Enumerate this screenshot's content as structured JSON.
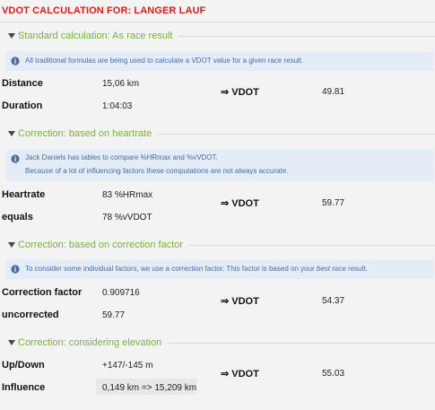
{
  "page": {
    "title": "VDOT CALCULATION FOR: LANGER LAUF"
  },
  "arrow": "⇒",
  "colors": {
    "title": "#e31b1b",
    "section": "#7bb13a",
    "info_bg": "#e3ecf7",
    "info_text": "#4a6ea0"
  },
  "sections": [
    {
      "heading": "Standard calculation: As race result",
      "info": [
        "All traditional formulas are being used to calculate a VDOT value for a given race result."
      ],
      "rows": [
        {
          "label": "Distance",
          "value": "15,06 km"
        },
        {
          "label": "Duration",
          "value": "1:04:03"
        }
      ],
      "vdot_label": "⇒ VDOT",
      "vdot_value": "49.81"
    },
    {
      "heading": "Correction: based on heartrate",
      "info": [
        "Jack Daniels has tables to compare %HRmax and %vVDOT.",
        "Because of a lot of influencing factors these computations are not always accurate."
      ],
      "rows": [
        {
          "label": "Heartrate",
          "value": "83 %HRmax"
        },
        {
          "label": "equals",
          "value": "78 %vVDOT"
        }
      ],
      "vdot_label": "⇒ VDOT",
      "vdot_value": "59.77"
    },
    {
      "heading": "Correction: based on correction factor",
      "info_parts": {
        "before": "To consider some individual factors, we use a correction factor. This factor is based on your ",
        "em": "best",
        "after": " race result."
      },
      "rows": [
        {
          "label": "Correction factor",
          "value": "0.909716"
        },
        {
          "label": "uncorrected",
          "value": "59.77"
        }
      ],
      "vdot_label": "⇒ VDOT",
      "vdot_value": "54.37"
    },
    {
      "heading": "Correction: considering elevation",
      "rows": [
        {
          "label": "Up/Down",
          "value": "+147/-145 m"
        },
        {
          "label": "Influence",
          "value": "0,149 km => 15,209 km"
        }
      ],
      "vdot_label": "⇒ VDOT",
      "vdot_value": "55.03"
    }
  ]
}
